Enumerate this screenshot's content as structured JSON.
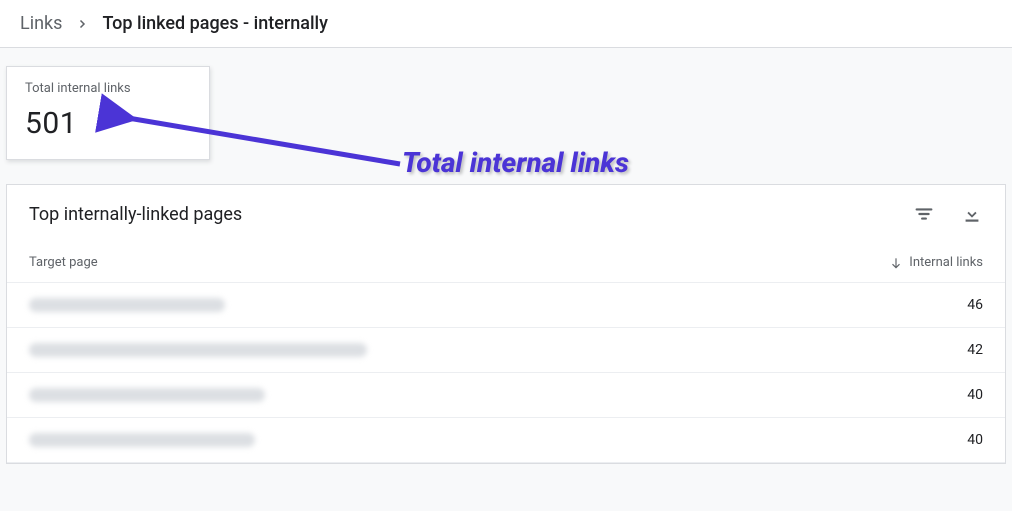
{
  "breadcrumb": {
    "root": "Links",
    "current": "Top linked pages - internally"
  },
  "stat": {
    "label": "Total internal links",
    "value": "501"
  },
  "annotation": {
    "label": "Total internal links"
  },
  "table": {
    "title": "Top internally-linked pages",
    "columns": {
      "target_page": "Target page",
      "internal_links": "Internal links"
    },
    "rows": [
      {
        "url_width": 196,
        "links": "46"
      },
      {
        "url_width": 338,
        "links": "42"
      },
      {
        "url_width": 236,
        "links": "40"
      },
      {
        "url_width": 226,
        "links": "40"
      }
    ]
  }
}
